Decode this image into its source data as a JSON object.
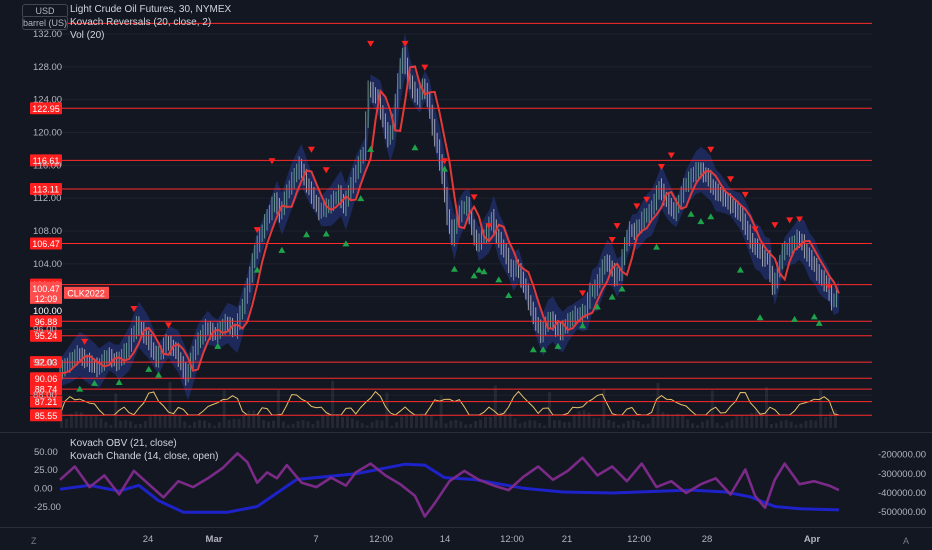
{
  "header": {
    "currency": "USD",
    "unit": "barrel (US)",
    "symbol_line": "Light Crude Oil Futures, 30, NYMEX",
    "indicator_1": "Kovach Reversals (20, close, 2)",
    "indicator_2": "Vol (20)",
    "lower_indicator_1": "Kovach OBV (21, close)",
    "lower_indicator_2": "Kovach Chande (14, close, open)"
  },
  "footer": {
    "left_button": "Z",
    "right_button": "A"
  },
  "chart_data": [
    {
      "type": "candlestick",
      "title": "Light Crude Oil Futures, 30, NYMEX",
      "ylim": [
        84.2,
        133.3
      ],
      "y_ticks": [
        "132.00",
        "128.00",
        "124.00",
        "120.00",
        "116.00",
        "112.00",
        "108.00",
        "104.00",
        "100.00",
        "96.00",
        "92.00",
        "88.00"
      ],
      "x_ticks": [
        "24",
        "Mar",
        "7",
        "12:00",
        "14",
        "12:00",
        "21",
        "12:00",
        "28",
        "Apr"
      ],
      "horizontal_levels": [
        {
          "value": 133.3,
          "label": ""
        },
        {
          "value": 122.95,
          "label": "122.95"
        },
        {
          "value": 116.61,
          "label": "116.61"
        },
        {
          "value": 113.11,
          "label": "113.11"
        },
        {
          "value": 106.47,
          "label": "106.47"
        },
        {
          "value": 101.46,
          "label": "101.46"
        },
        {
          "value": 97.0,
          "label": "96.88"
        },
        {
          "value": 95.24,
          "label": "95.24"
        },
        {
          "value": 92.03,
          "label": "92.03"
        },
        {
          "value": 90.06,
          "label": "90.06"
        },
        {
          "value": 88.74,
          "label": "88.74"
        },
        {
          "value": 87.21,
          "label": "87.21"
        },
        {
          "value": 85.55,
          "label": "85.55"
        }
      ],
      "price_tag": {
        "value": 100.47,
        "time": "12:09",
        "symbol": "CLK2022",
        "below": "100.00"
      },
      "price_path": [
        [
          0,
          90.7
        ],
        [
          2,
          91.8
        ],
        [
          4,
          93.0
        ],
        [
          6,
          92.1
        ],
        [
          8,
          91.3
        ],
        [
          10,
          92.8
        ],
        [
          12,
          92.0
        ],
        [
          14,
          93.6
        ],
        [
          16,
          96.6
        ],
        [
          18,
          95.0
        ],
        [
          20,
          92.4
        ],
        [
          22,
          94.5
        ],
        [
          24,
          93.3
        ],
        [
          26,
          90.2
        ],
        [
          28,
          94.0
        ],
        [
          30,
          96.2
        ],
        [
          32,
          95.4
        ],
        [
          34,
          96.8
        ],
        [
          36,
          95.9
        ],
        [
          38,
          100.0
        ],
        [
          40,
          105.6
        ],
        [
          42,
          109.0
        ],
        [
          44,
          111.8
        ],
        [
          45,
          110.1
        ],
        [
          47,
          113.5
        ],
        [
          49,
          116.0
        ],
        [
          51,
          113.0
        ],
        [
          53,
          110.4
        ],
        [
          55,
          111.1
        ],
        [
          57,
          112.6
        ],
        [
          58,
          110.9
        ],
        [
          60,
          114.6
        ],
        [
          62,
          117.6
        ],
        [
          63,
          125.4
        ],
        [
          65,
          124.0
        ],
        [
          66,
          121.3
        ],
        [
          67,
          119.2
        ],
        [
          68,
          121.2
        ],
        [
          69,
          126.4
        ],
        [
          70,
          129.5
        ],
        [
          71,
          126.6
        ],
        [
          72,
          125.2
        ],
        [
          73,
          124.1
        ],
        [
          74,
          125.7
        ],
        [
          75,
          124.2
        ],
        [
          76,
          120.6
        ],
        [
          77,
          118.1
        ],
        [
          78,
          114.7
        ],
        [
          79,
          109.8
        ],
        [
          80,
          107.2
        ],
        [
          81,
          109.5
        ],
        [
          82,
          110.7
        ],
        [
          83,
          111.2
        ],
        [
          84,
          108.3
        ],
        [
          85,
          106.4
        ],
        [
          87,
          107.9
        ],
        [
          88,
          109.6
        ],
        [
          89,
          107.4
        ],
        [
          90,
          106.2
        ],
        [
          91,
          104.9
        ],
        [
          92,
          103.0
        ],
        [
          93,
          103.8
        ],
        [
          94,
          102.2
        ],
        [
          95,
          100.5
        ],
        [
          96,
          98.4
        ],
        [
          97,
          96.9
        ],
        [
          98,
          95.4
        ],
        [
          99,
          96.8
        ],
        [
          100,
          97.3
        ],
        [
          101,
          96.2
        ],
        [
          102,
          95.7
        ],
        [
          103,
          96.6
        ],
        [
          104,
          97.2
        ],
        [
          105,
          97.8
        ],
        [
          106,
          97.8
        ],
        [
          107,
          98.3
        ],
        [
          108,
          100.7
        ],
        [
          109,
          101.0
        ],
        [
          110,
          102.7
        ],
        [
          111,
          104.2
        ],
        [
          112,
          103.8
        ],
        [
          113,
          102.3
        ],
        [
          114,
          103.0
        ],
        [
          115,
          106.4
        ],
        [
          116,
          108.1
        ],
        [
          117,
          107.9
        ],
        [
          118,
          108.8
        ],
        [
          119,
          109.8
        ],
        [
          120,
          110.2
        ],
        [
          121,
          111.6
        ],
        [
          122,
          113.4
        ],
        [
          123,
          112.1
        ],
        [
          124,
          111.1
        ],
        [
          125,
          110.3
        ],
        [
          126,
          111.6
        ],
        [
          127,
          113.4
        ],
        [
          128,
          114.2
        ],
        [
          129,
          115.1
        ],
        [
          130,
          115.5
        ],
        [
          131,
          115.0
        ],
        [
          132,
          114.4
        ],
        [
          133,
          113.0
        ],
        [
          134,
          112.6
        ],
        [
          135,
          112.1
        ],
        [
          136,
          111.5
        ],
        [
          137,
          110.9
        ],
        [
          138,
          110.4
        ],
        [
          139,
          109.2
        ],
        [
          140,
          107.7
        ],
        [
          141,
          106.2
        ],
        [
          142,
          105.8
        ],
        [
          143,
          104.7
        ],
        [
          144,
          104.6
        ],
        [
          145,
          101.1
        ],
        [
          146,
          103.1
        ],
        [
          147,
          105.5
        ],
        [
          148,
          105.9
        ],
        [
          149,
          106.4
        ],
        [
          150,
          107.1
        ],
        [
          151,
          106.5
        ],
        [
          152,
          105.0
        ],
        [
          153,
          104.3
        ],
        [
          154,
          103.0
        ],
        [
          155,
          102.1
        ],
        [
          156,
          101.4
        ],
        [
          157,
          99.4
        ],
        [
          158,
          100.0
        ]
      ],
      "price_count": 158,
      "sell_signals": [
        [
          5,
          94.5
        ],
        [
          15,
          98.5
        ],
        [
          22,
          96.5
        ],
        [
          40,
          108.1
        ],
        [
          43,
          116.5
        ],
        [
          51,
          117.9
        ],
        [
          54,
          115.4
        ],
        [
          63,
          130.8
        ],
        [
          70,
          130.8
        ],
        [
          74,
          127.9
        ],
        [
          78,
          116.5
        ],
        [
          84,
          112.1
        ],
        [
          87,
          108.6
        ],
        [
          106,
          100.4
        ],
        [
          112,
          106.9
        ],
        [
          113,
          108.6
        ],
        [
          117,
          111.0
        ],
        [
          119,
          111.8
        ],
        [
          122,
          115.8
        ],
        [
          124,
          117.2
        ],
        [
          132,
          117.9
        ],
        [
          136,
          114.3
        ],
        [
          139,
          112.4
        ],
        [
          141,
          108.2
        ],
        [
          145,
          108.7
        ],
        [
          148,
          109.3
        ],
        [
          150,
          109.4
        ],
        [
          156,
          101.2
        ]
      ],
      "buy_signals": [
        [
          4,
          88.8
        ],
        [
          7,
          89.5
        ],
        [
          12,
          89.6
        ],
        [
          18,
          91.2
        ],
        [
          20,
          90.5
        ],
        [
          32,
          94.0
        ],
        [
          40,
          103.3
        ],
        [
          45,
          105.7
        ],
        [
          50,
          107.6
        ],
        [
          54,
          107.7
        ],
        [
          58,
          106.5
        ],
        [
          61,
          112.0
        ],
        [
          63,
          118.0
        ],
        [
          72,
          118.2
        ],
        [
          78,
          115.6
        ],
        [
          80,
          103.4
        ],
        [
          84,
          102.6
        ],
        [
          85,
          103.3
        ],
        [
          86,
          103.1
        ],
        [
          89,
          102.1
        ],
        [
          91,
          100.2
        ],
        [
          96,
          93.6
        ],
        [
          98,
          93.6
        ],
        [
          101,
          94.0
        ],
        [
          106,
          96.5
        ],
        [
          109,
          98.8
        ],
        [
          112,
          100.0
        ],
        [
          114,
          101.0
        ],
        [
          121,
          106.1
        ],
        [
          128,
          110.1
        ],
        [
          130,
          109.2
        ],
        [
          132,
          109.8
        ],
        [
          138,
          103.3
        ],
        [
          142,
          97.5
        ],
        [
          149,
          97.3
        ],
        [
          153,
          97.6
        ],
        [
          154,
          96.8
        ]
      ]
    },
    {
      "type": "line",
      "title": "Kovach OBV (21, close) / Kovach Chande (14, close, open)",
      "left_ylim": [
        -40,
        62
      ],
      "right_ylim": [
        -530000,
        -140000
      ],
      "left_ticks": [
        "50.00",
        "25.00",
        "0.00",
        "-25.00"
      ],
      "right_ticks": [
        "-200000.00",
        "-300000.00",
        "-400000.00",
        "-500000.00"
      ],
      "series": [
        {
          "name": "Kovach OBV (21, close)",
          "color": "#1e22c9",
          "axis": "right",
          "points": [
            [
              0,
              -380000
            ],
            [
              6,
              -360000
            ],
            [
              12,
              -390000
            ],
            [
              16,
              -360000
            ],
            [
              20,
              -440000
            ],
            [
              25,
              -500000
            ],
            [
              34,
              -500000
            ],
            [
              40,
              -470000
            ],
            [
              48,
              -330000
            ],
            [
              60,
              -300000
            ],
            [
              70,
              -250000
            ],
            [
              74,
              -255000
            ],
            [
              78,
              -320000
            ],
            [
              84,
              -330000
            ],
            [
              94,
              -375000
            ],
            [
              102,
              -395000
            ],
            [
              112,
              -400000
            ],
            [
              122,
              -390000
            ],
            [
              128,
              -385000
            ],
            [
              135,
              -395000
            ],
            [
              140,
              -420000
            ],
            [
              145,
              -470000
            ],
            [
              150,
              -482000
            ],
            [
              158,
              -488000
            ]
          ]
        },
        {
          "name": "Kovach Chande (14, close, open)",
          "color": "#7b2a87",
          "axis": "left",
          "points": [
            [
              0,
              12
            ],
            [
              3,
              30
            ],
            [
              6,
              2
            ],
            [
              9,
              18
            ],
            [
              12,
              -8
            ],
            [
              15,
              24
            ],
            [
              18,
              6
            ],
            [
              21,
              -12
            ],
            [
              24,
              10
            ],
            [
              27,
              2
            ],
            [
              30,
              14
            ],
            [
              33,
              28
            ],
            [
              36,
              48
            ],
            [
              38,
              36
            ],
            [
              40,
              8
            ],
            [
              42,
              22
            ],
            [
              44,
              14
            ],
            [
              46,
              32
            ],
            [
              49,
              8
            ],
            [
              52,
              2
            ],
            [
              55,
              15
            ],
            [
              58,
              4
            ],
            [
              60,
              22
            ],
            [
              63,
              34
            ],
            [
              66,
              18
            ],
            [
              69,
              6
            ],
            [
              72,
              -10
            ],
            [
              74,
              -38
            ],
            [
              76,
              -20
            ],
            [
              79,
              10
            ],
            [
              82,
              24
            ],
            [
              85,
              12
            ],
            [
              88,
              4
            ],
            [
              91,
              -2
            ],
            [
              94,
              16
            ],
            [
              97,
              30
            ],
            [
              100,
              12
            ],
            [
              103,
              24
            ],
            [
              106,
              42
            ],
            [
              109,
              18
            ],
            [
              112,
              30
            ],
            [
              115,
              10
            ],
            [
              118,
              34
            ],
            [
              121,
              2
            ],
            [
              124,
              10
            ],
            [
              127,
              -6
            ],
            [
              130,
              6
            ],
            [
              133,
              14
            ],
            [
              136,
              -8
            ],
            [
              139,
              26
            ],
            [
              141,
              -10
            ],
            [
              143,
              -26
            ],
            [
              145,
              12
            ],
            [
              147,
              34
            ],
            [
              150,
              6
            ],
            [
              153,
              10
            ],
            [
              156,
              4
            ],
            [
              158,
              -2
            ]
          ]
        }
      ]
    }
  ]
}
